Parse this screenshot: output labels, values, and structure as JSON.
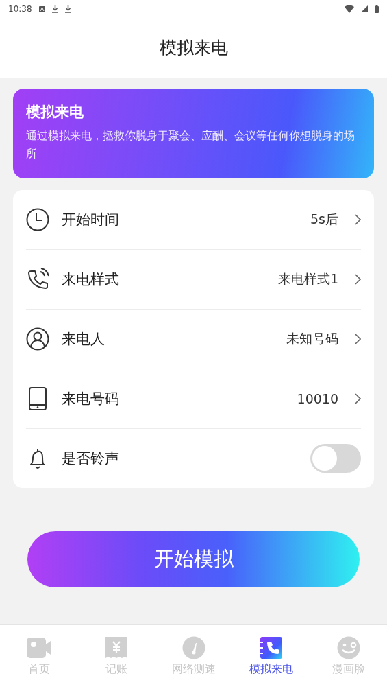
{
  "status_bar": {
    "time": "10:38"
  },
  "header": {
    "title": "模拟来电"
  },
  "banner": {
    "title": "模拟来电",
    "text": "通过模拟来电，拯救你脱身于聚会、应酬、会议等任何你想脱身的场所"
  },
  "settings": [
    {
      "kind": "value",
      "label": "开始时间",
      "value": "5s后"
    },
    {
      "kind": "value",
      "label": "来电样式",
      "value": "来电样式1"
    },
    {
      "kind": "value",
      "label": "来电人",
      "value": "未知号码"
    },
    {
      "kind": "value",
      "label": "来电号码",
      "value": "10010"
    },
    {
      "kind": "toggle",
      "label": "是否铃声",
      "on": false
    }
  ],
  "start_button": "开始模拟",
  "tabs": [
    {
      "label": "首页",
      "selected": false
    },
    {
      "label": "记账",
      "selected": false
    },
    {
      "label": "网络测速",
      "selected": false
    },
    {
      "label": "模拟来电",
      "selected": true
    },
    {
      "label": "漫画脸",
      "selected": false
    }
  ]
}
